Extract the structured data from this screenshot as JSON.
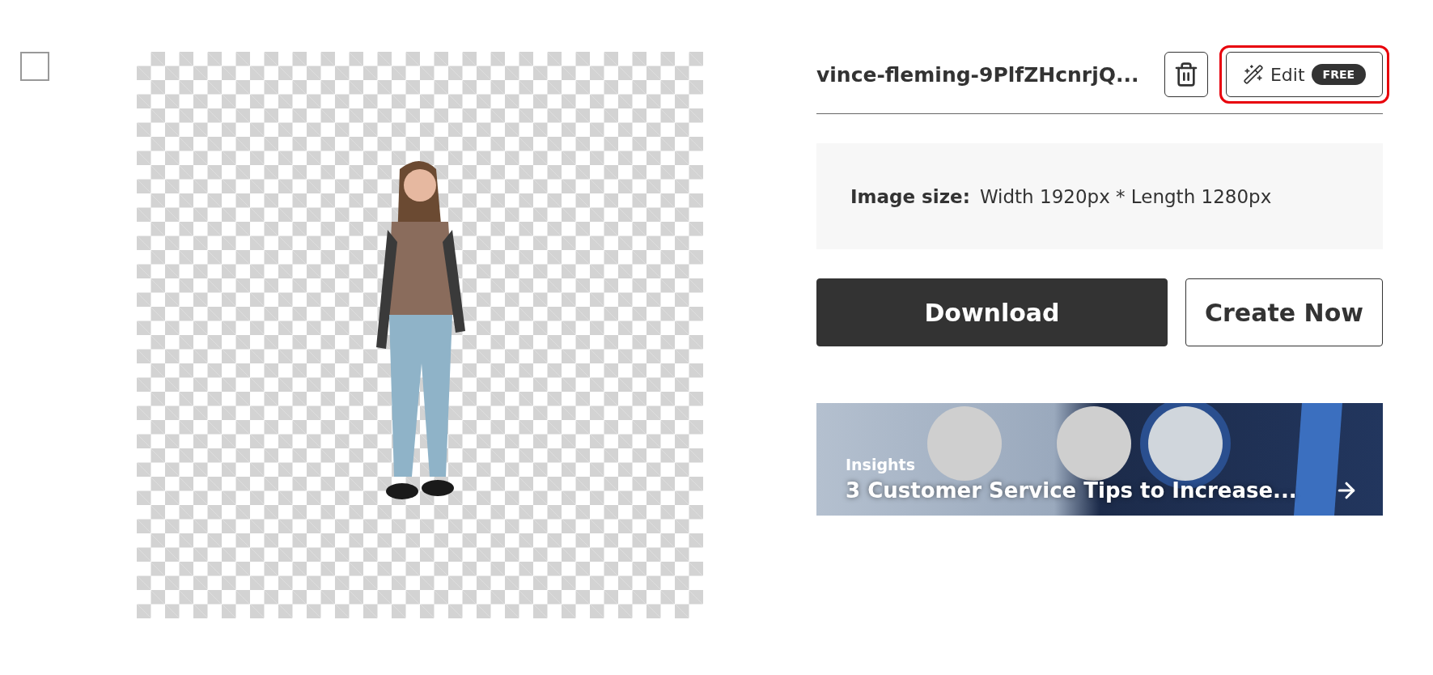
{
  "select": {
    "checked": false
  },
  "file": {
    "name": "vince-fleming-9PlfZHcnrjQ...",
    "edit_label": "Edit",
    "edit_badge": "FREE",
    "highlighted": true
  },
  "info": {
    "label": "Image size:",
    "value": "Width 1920px * Length 1280px"
  },
  "actions": [
    {
      "label": "Download",
      "kind": "primary"
    },
    {
      "label": "Create Now",
      "kind": "secondary"
    }
  ],
  "banner": {
    "tag": "Insights",
    "title": "3 Customer Service Tips to Increase..."
  }
}
